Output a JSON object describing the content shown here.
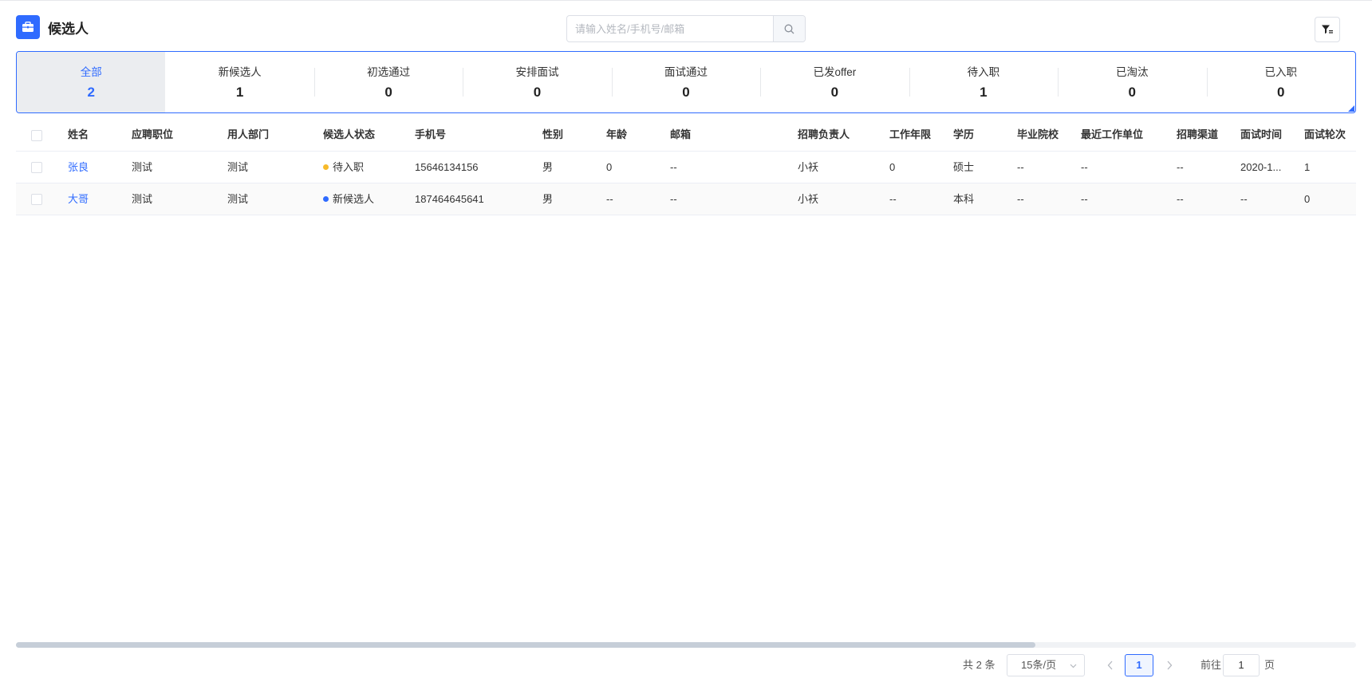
{
  "header": {
    "title": "候选人",
    "search_placeholder": "请输入姓名/手机号/邮箱"
  },
  "tabs": [
    {
      "label": "全部",
      "count": "2",
      "active": true
    },
    {
      "label": "新候选人",
      "count": "1"
    },
    {
      "label": "初选通过",
      "count": "0"
    },
    {
      "label": "安排面试",
      "count": "0"
    },
    {
      "label": "面试通过",
      "count": "0"
    },
    {
      "label": "已发offer",
      "count": "0"
    },
    {
      "label": "待入职",
      "count": "1"
    },
    {
      "label": "已淘汰",
      "count": "0"
    },
    {
      "label": "已入职",
      "count": "0"
    }
  ],
  "table": {
    "columns": [
      "姓名",
      "应聘职位",
      "用人部门",
      "候选人状态",
      "手机号",
      "性别",
      "年龄",
      "邮箱",
      "招聘负责人",
      "工作年限",
      "学历",
      "毕业院校",
      "最近工作单位",
      "招聘渠道",
      "面试时间",
      "面试轮次"
    ],
    "rows": [
      {
        "name": "张良",
        "position": "测试",
        "department": "测试",
        "status": "待入职",
        "status_color": "#f7ba2a",
        "phone": "15646134156",
        "gender": "男",
        "age": "0",
        "email": "--",
        "recruiter": "小袄",
        "years": "0",
        "education": "硕士",
        "school": "--",
        "last_company": "--",
        "channel": "--",
        "interview_time": "2020-1...",
        "rounds": "1"
      },
      {
        "name": "大哥",
        "position": "测试",
        "department": "测试",
        "status": "新候选人",
        "status_color": "#2f6bff",
        "phone": "187464645641",
        "gender": "男",
        "age": "--",
        "email": "--",
        "recruiter": "小袄",
        "years": "--",
        "education": "本科",
        "school": "--",
        "last_company": "--",
        "channel": "--",
        "interview_time": "--",
        "rounds": "0"
      }
    ]
  },
  "scrollbar": {
    "horizontal_position": 0.0,
    "visible_fraction": 0.76
  },
  "pagination": {
    "total": "共 2 条",
    "page_size": "15条/页",
    "current_page": "1",
    "goto_label": "前往",
    "goto_value": "1",
    "page_suffix": "页"
  },
  "colors": {
    "accent": "#2f6bff",
    "tab_active_bg": "#ebedf0",
    "status_pending": "#f7ba2a",
    "status_new": "#2f6bff"
  }
}
